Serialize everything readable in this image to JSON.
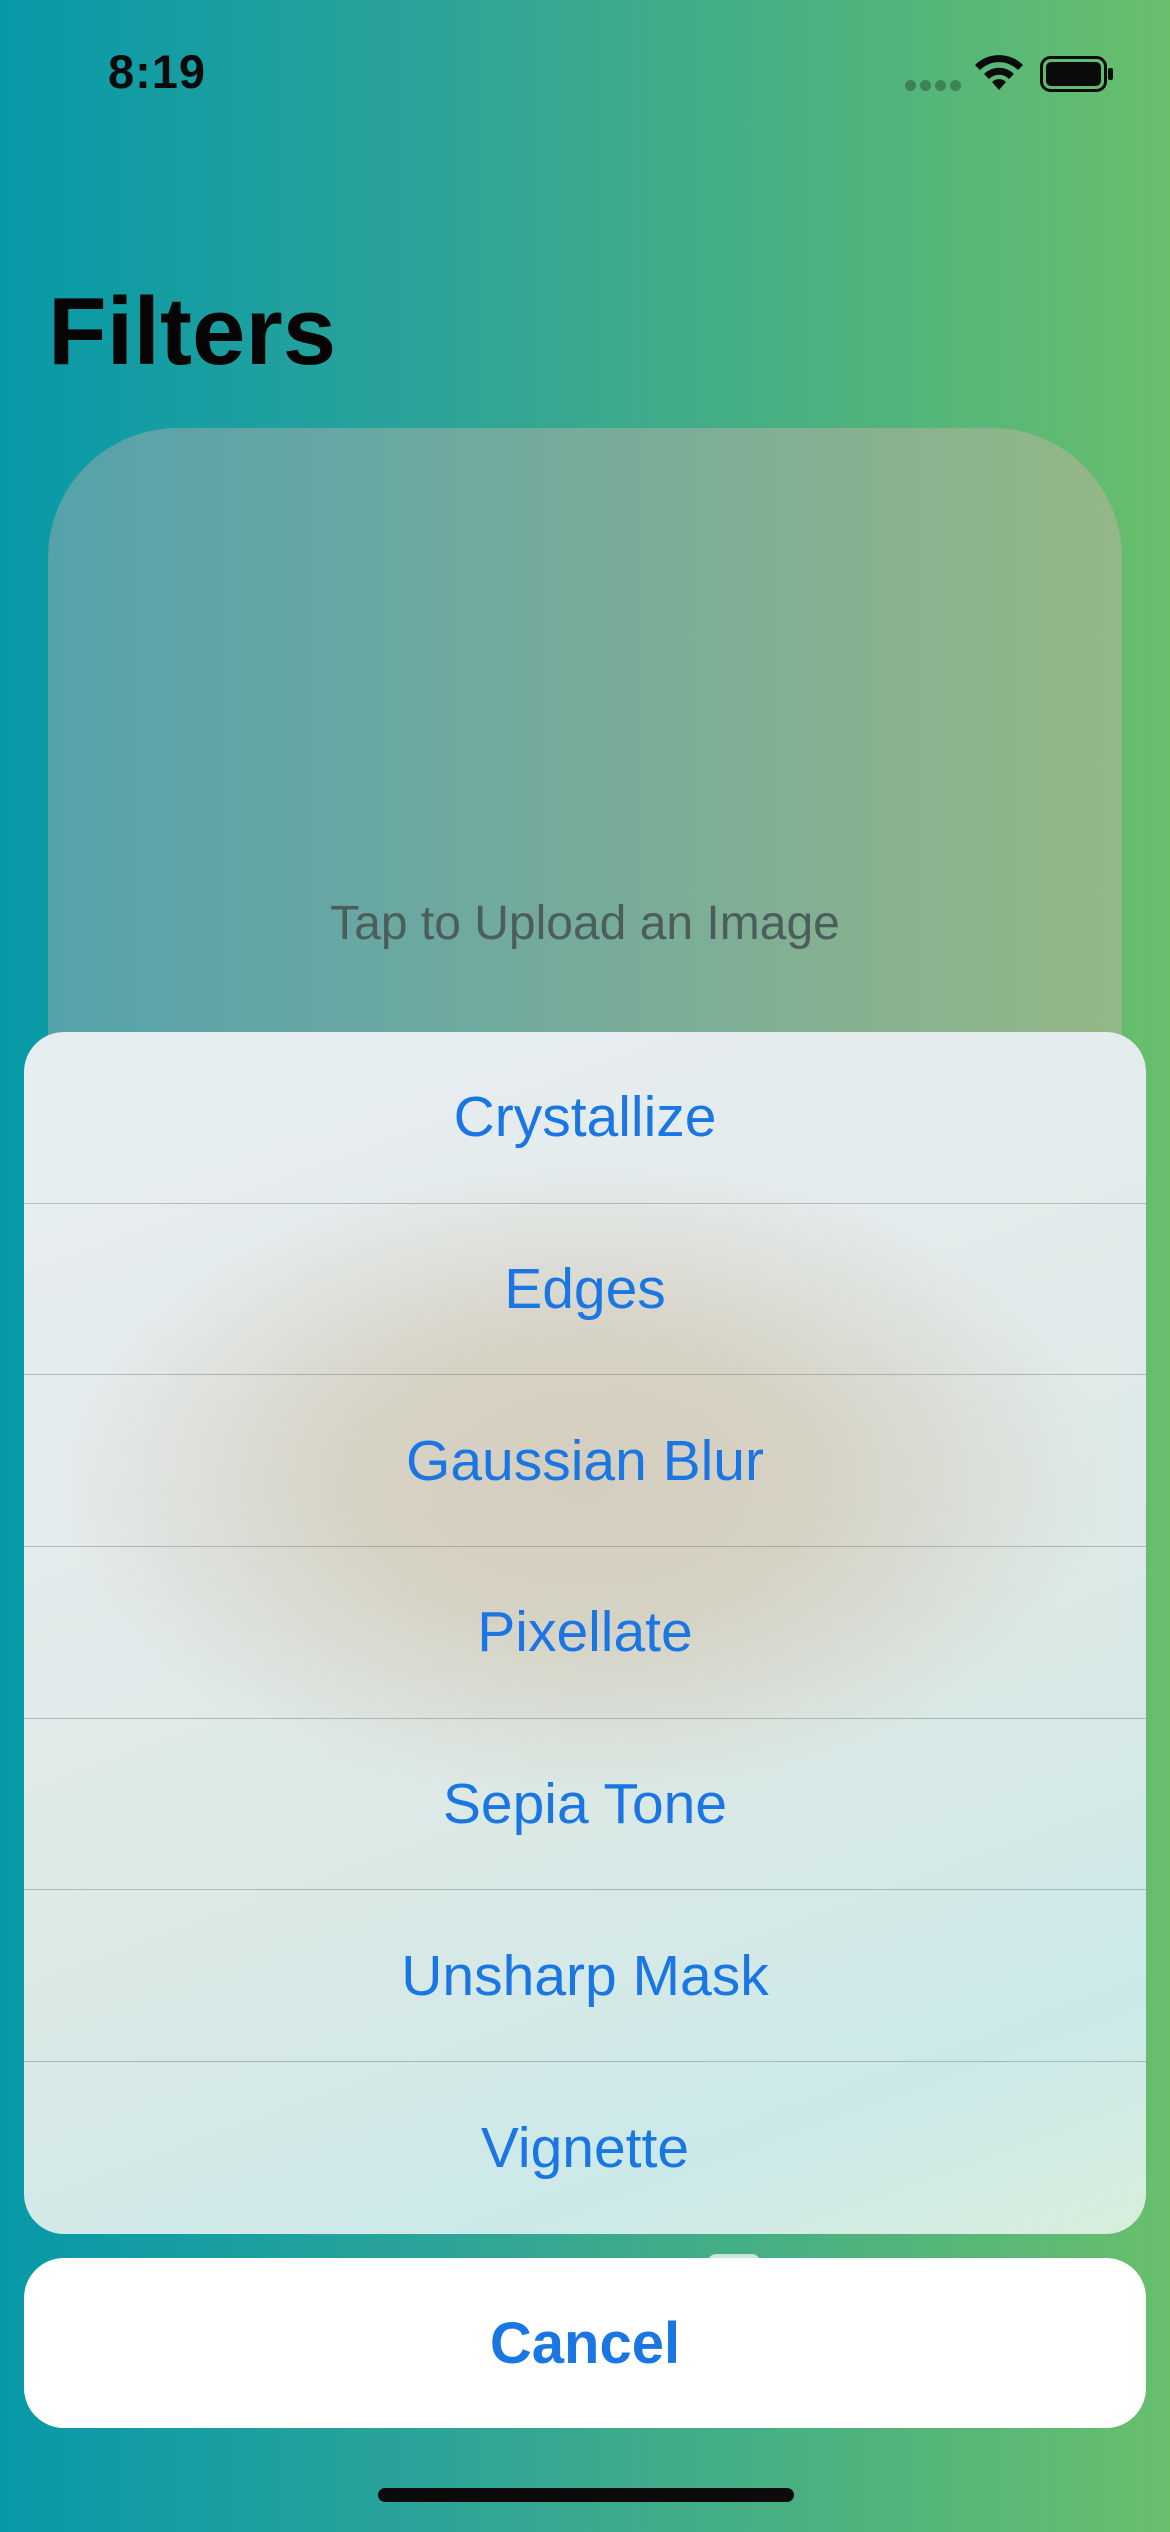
{
  "status_bar": {
    "time": "8:19"
  },
  "page": {
    "title": "Filters"
  },
  "image_card": {
    "placeholder_text": "Tap to Upload an Image"
  },
  "action_sheet": {
    "items": [
      {
        "label": "Crystallize"
      },
      {
        "label": "Edges"
      },
      {
        "label": "Gaussian Blur"
      },
      {
        "label": "Pixellate"
      },
      {
        "label": "Sepia Tone"
      },
      {
        "label": "Unsharp Mask"
      },
      {
        "label": "Vignette"
      }
    ],
    "cancel_label": "Cancel"
  },
  "colors": {
    "accent": "#1a76e3",
    "background_start": "#0799a8",
    "background_end": "#68bf6c"
  }
}
